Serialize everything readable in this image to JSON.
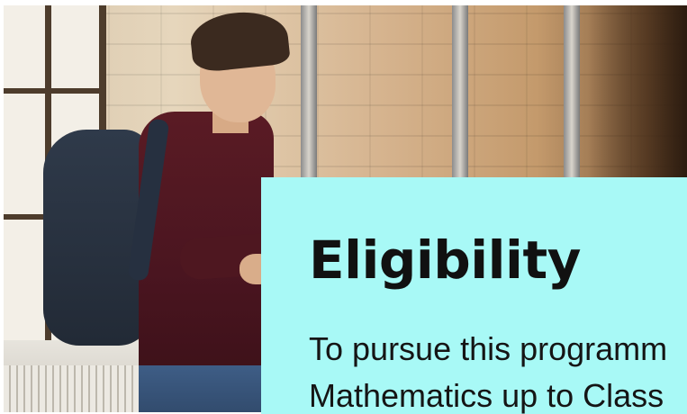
{
  "hero": {
    "image_subject": "student-with-backpack-photo"
  },
  "card": {
    "title": "Eligibility",
    "body_lines": [
      "To pursue this programm",
      "Mathematics up to Class"
    ],
    "background_color": "#a8f9f6",
    "text_color": "#111111"
  }
}
